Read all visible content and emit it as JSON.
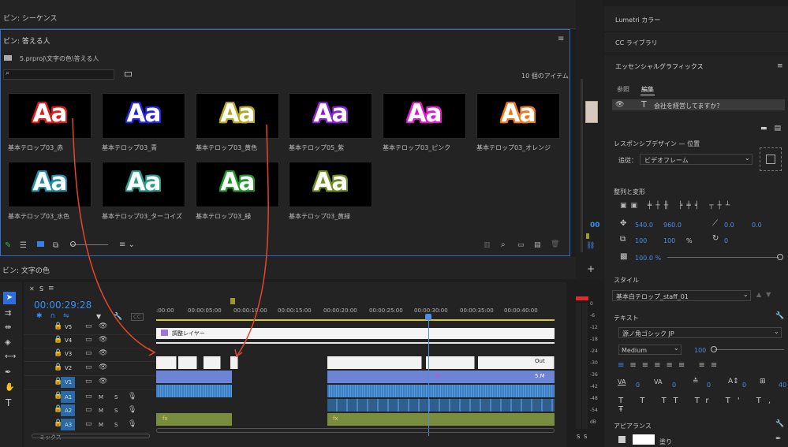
{
  "bins": {
    "sequence_title": "ビン: シーケンス",
    "answer_title": "ビン: 答える人",
    "path": "5.prproj\\文字の色\\答える人",
    "item_count": "10 個のアイテム",
    "text_color_title": "ビン: 文字の色",
    "items": [
      {
        "glyph": "Aa",
        "label": "基本テロップ03_赤",
        "color": "#e01b1b"
      },
      {
        "glyph": "Aa",
        "label": "基本テロップ03_青",
        "color": "#2323e0"
      },
      {
        "glyph": "Aa",
        "label": "基本テロップ03_黄色",
        "color": "#b6a81e"
      },
      {
        "glyph": "Aa",
        "label": "基本テロップ05_紫",
        "color": "#8b1fd6"
      },
      {
        "glyph": "Aa",
        "label": "基本テロップ03_ピンク",
        "color": "#e019c8"
      },
      {
        "glyph": "Aa",
        "label": "基本テロップ03_オレンジ",
        "color": "#ec7a18"
      },
      {
        "glyph": "Aa",
        "label": "基本テロップ03_水色",
        "color": "#1e8fa8"
      },
      {
        "glyph": "Aa",
        "label": "基本テロップ03_ターコイズ",
        "color": "#2a9c8a"
      },
      {
        "glyph": "Aa",
        "label": "基本テロップ03_緑",
        "color": "#1e9a2a"
      },
      {
        "glyph": "Aa",
        "label": "基本テロップ03_黄緑",
        "color": "#6e8e1c"
      }
    ]
  },
  "timeline": {
    "tab": "S",
    "timecode": "00:00:29:28",
    "ruler": [
      ":00:00",
      "00:00:05:00",
      "00:00:10:00",
      "00:00:15:00",
      "00:00:20:00",
      "00:00:25:00",
      "00:00:30:00",
      "00:00:35:00",
      "00:00:40:00"
    ],
    "video_tracks": [
      "V5",
      "V4",
      "V3",
      "V2",
      "V1"
    ],
    "audio_tracks": [
      "A1",
      "A2",
      "A3"
    ],
    "mix_label": "ミックス",
    "adjustment_layer": "調整レイヤー",
    "out_label": "Out",
    "clip_5m": "5.M",
    "fx": "fx",
    "audio_labels": [
      "M",
      "S"
    ]
  },
  "meter": {
    "ticks": [
      "0",
      "-6",
      "-12",
      "-18",
      "-24",
      "-30",
      "-36",
      "-42",
      "-48",
      "-54",
      "dB"
    ],
    "solo": [
      "S",
      "S"
    ]
  },
  "right": {
    "lumetri": "Lumetri カラー",
    "cc": "CC ライブラリ",
    "eg_title": "エッセンシャルグラフィックス",
    "tab_browse": "参照",
    "tab_edit": "編集",
    "layer_text": "会社を経営してますか？",
    "responsive_title": "レスポンシブデザイン — 位置",
    "follow_label": "追従：",
    "follow_value": "ビデオフレーム",
    "align_title": "整列と変形",
    "pos_x": "540.0",
    "pos_y": "960.0",
    "anchor_x": "0.0",
    "anchor_y": "0.0",
    "scale_w": "100",
    "scale_h": "100",
    "scale_unit": "%",
    "rotation": "0",
    "opacity": "100.0 %",
    "style_title": "スタイル",
    "style_value": "基本白テロップ_staff_01",
    "text_title": "テキスト",
    "font": "源ノ角ゴシック JP",
    "weight": "Medium",
    "size": "100",
    "va": "0",
    "va2": "0",
    "tsume": "0",
    "tsume2": "40",
    "tt_buttons": [
      "T",
      "T",
      "TT",
      "Tr",
      "T'",
      "T,",
      "Ŧ"
    ],
    "appearance_title": "アピアランス",
    "fill_label": "塗り",
    "side_num": "00"
  }
}
